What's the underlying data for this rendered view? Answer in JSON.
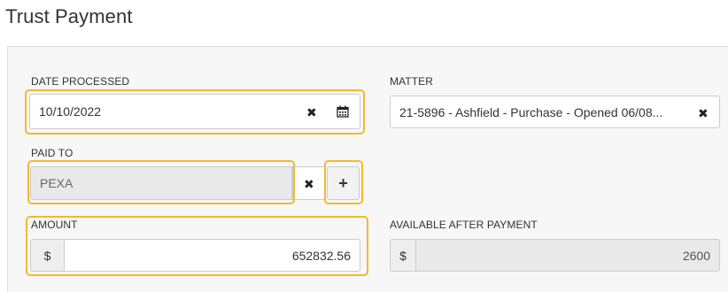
{
  "page": {
    "title": "Trust Payment"
  },
  "form": {
    "date_processed": {
      "label": "DATE PROCESSED",
      "value": "10/10/2022"
    },
    "matter": {
      "label": "MATTER",
      "value": "21-5896 - Ashfield - Purchase - Opened 06/08..."
    },
    "paid_to": {
      "label": "PAID TO",
      "value": "PEXA",
      "add_label": "+"
    },
    "amount": {
      "label": "AMOUNT",
      "currency": "$",
      "value": "652832.56"
    },
    "available_after_payment": {
      "label": "AVAILABLE AFTER PAYMENT",
      "currency": "$",
      "value": "2600"
    },
    "clear_glyph": "✖"
  },
  "colors": {
    "highlight": "#f5b82e",
    "panel_bg": "#f7f7f7",
    "readonly_bg": "#e9e9e9"
  },
  "icons": {
    "clear": "close-icon",
    "calendar": "calendar-icon",
    "add": "plus-icon"
  }
}
